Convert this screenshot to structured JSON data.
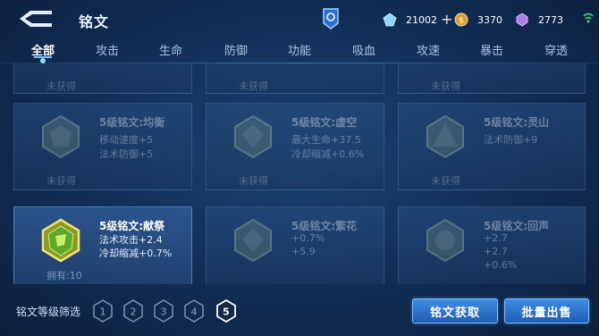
{
  "header": {
    "title": "铭文"
  },
  "resources": [
    {
      "icon": "gem-icon",
      "value": "21002",
      "has_plus": true
    },
    {
      "icon": "gold-coin-icon",
      "value": "3370",
      "has_plus": false
    },
    {
      "icon": "crystal-icon",
      "value": "2773",
      "has_plus": false
    }
  ],
  "tabs": [
    {
      "label": "全部",
      "active": true
    },
    {
      "label": "攻击",
      "active": false
    },
    {
      "label": "生命",
      "active": false
    },
    {
      "label": "防御",
      "active": false
    },
    {
      "label": "功能",
      "active": false
    },
    {
      "label": "吸血",
      "active": false
    },
    {
      "label": "攻速",
      "active": false
    },
    {
      "label": "暴击",
      "active": false
    },
    {
      "label": "穿透",
      "active": false
    }
  ],
  "cards_row0": [
    {
      "stat_partial": "",
      "status": "未获得"
    },
    {
      "stat_partial": "",
      "status": "未获得"
    },
    {
      "stat_partial": "",
      "status": "未获得"
    }
  ],
  "cards_row1": [
    {
      "name": "5级铭文:均衡",
      "stats": [
        "移动速度+5",
        "法术防御+5"
      ],
      "status": "未获得"
    },
    {
      "name": "5级铭文:虚空",
      "stats": [
        "最大生命+37.5",
        "冷却缩减+0.6%"
      ],
      "status": "未获得"
    },
    {
      "name": "5级铭文:灵山",
      "stats": [
        "法术防御+9"
      ],
      "status": "未获得"
    }
  ],
  "cards_row2": [
    {
      "name": "5级铭文:献祭",
      "stats": [
        "法术攻击+2.4",
        "冷却缩减+0.7%"
      ],
      "status": "拥有:10"
    },
    {
      "name": "5级铭文:繁花",
      "stats": [
        "+0.7%",
        "+5.9"
      ],
      "status": ""
    },
    {
      "name": "5级铭文:回声",
      "stats": [
        "+2.7",
        "+2.7",
        "+0.6%"
      ],
      "status": ""
    }
  ],
  "filter": {
    "label": "铭文等级筛选",
    "levels": [
      "1",
      "2",
      "3",
      "4",
      "5"
    ],
    "selected": "5"
  },
  "buttons": {
    "acquire": "铭文获取",
    "bulk_sell": "批量出售"
  }
}
